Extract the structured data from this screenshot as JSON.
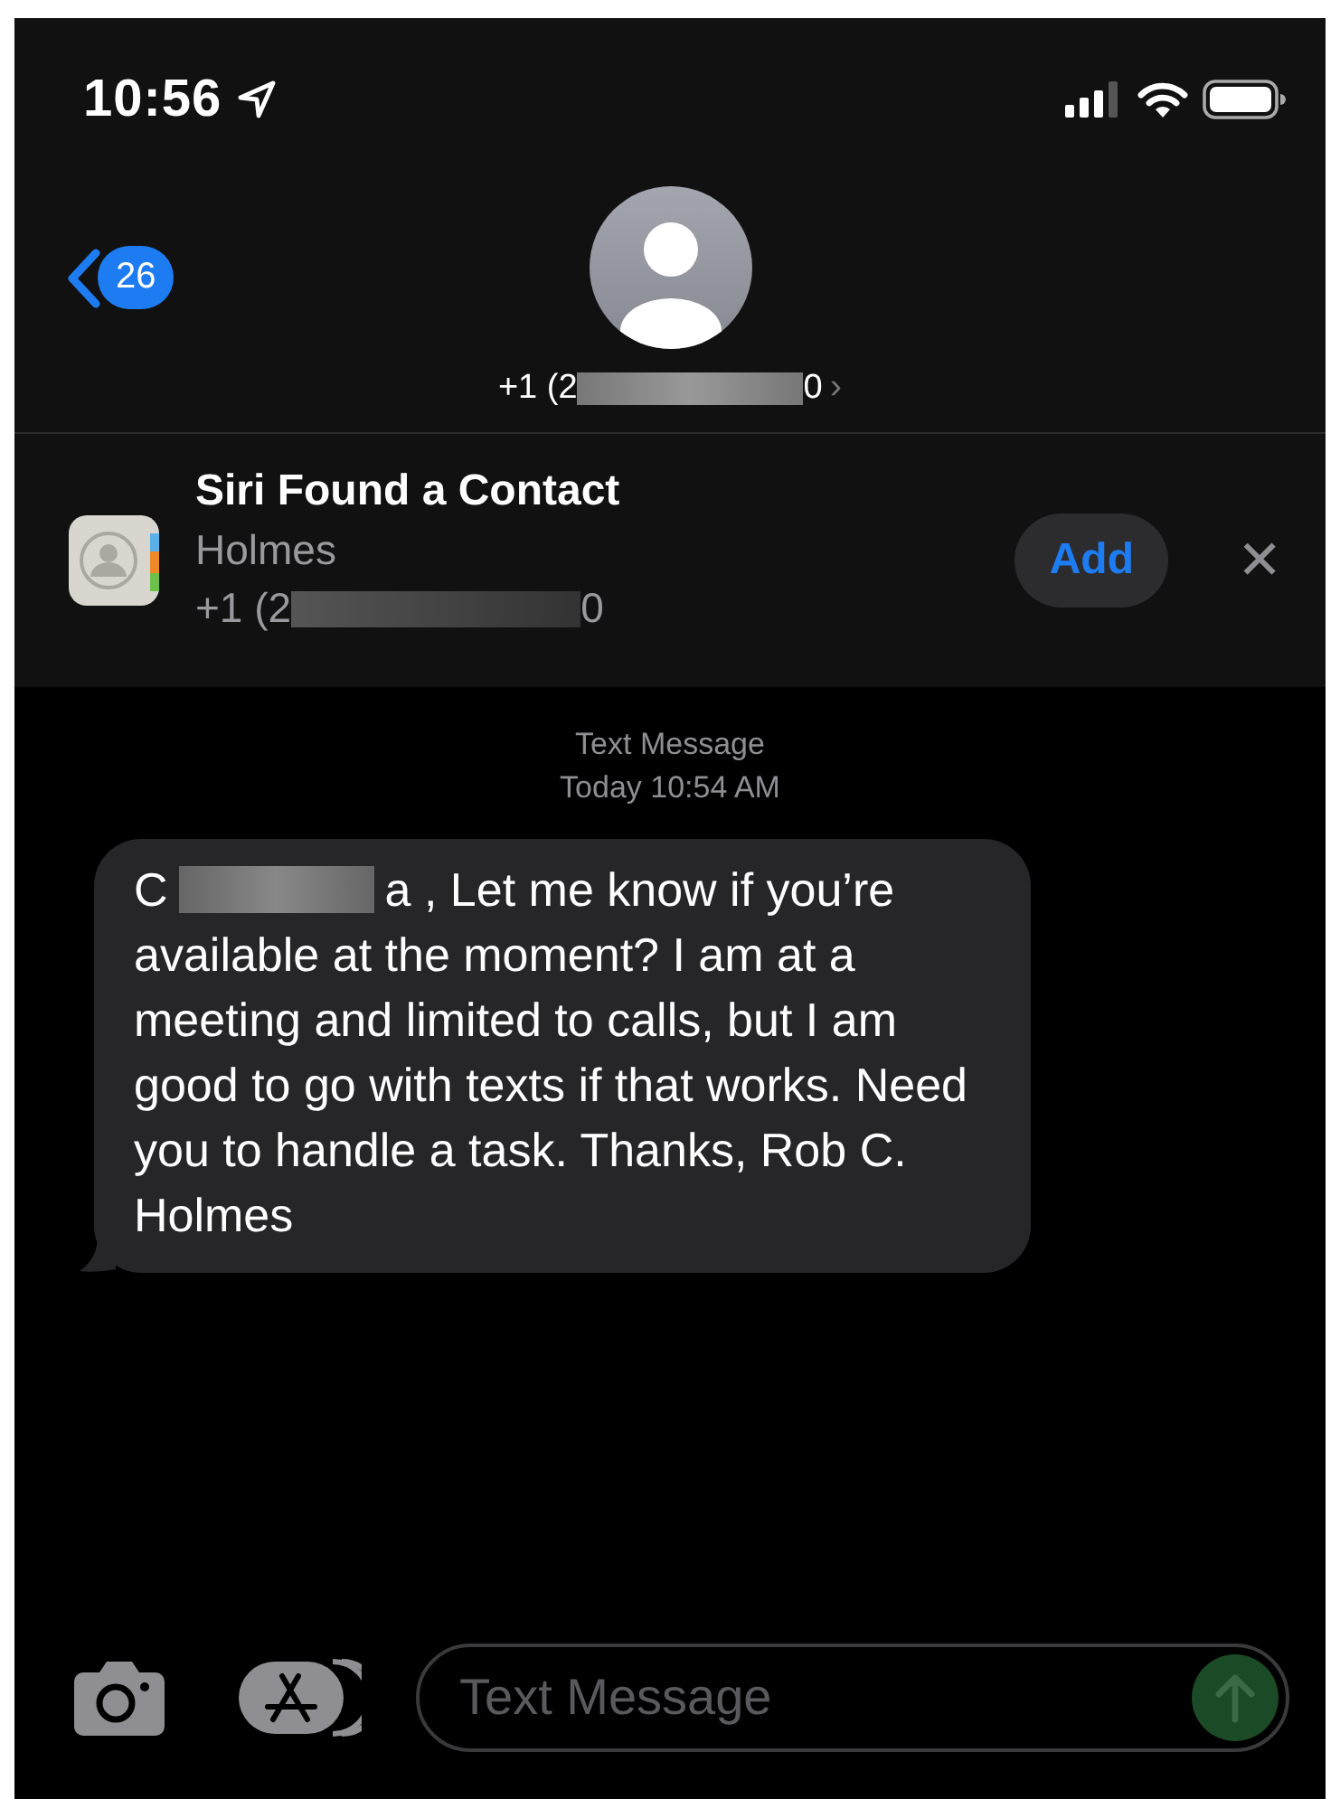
{
  "status_bar": {
    "time": "10:56"
  },
  "header": {
    "back_badge": "26",
    "phone_start": "+1 (2",
    "phone_end": "0",
    "chevron": "›"
  },
  "siri_banner": {
    "title": "Siri Found a Contact",
    "name": "Holmes",
    "phone_start": "+1 (2",
    "phone_end": "0",
    "add_button": "Add",
    "close": "✕"
  },
  "thread": {
    "service": "Text Message",
    "timestamp": "Today 10:54 AM",
    "messages": [
      {
        "kind": "received",
        "start": "C",
        "first_line": "a , Let me know if you’re",
        "text": "available at the moment?  I am at a meeting and limited to calls, but I am good to go with texts if that works. Need you to handle a task. Thanks, Rob C. Holmes"
      }
    ]
  },
  "compose": {
    "placeholder": "Text Message"
  }
}
